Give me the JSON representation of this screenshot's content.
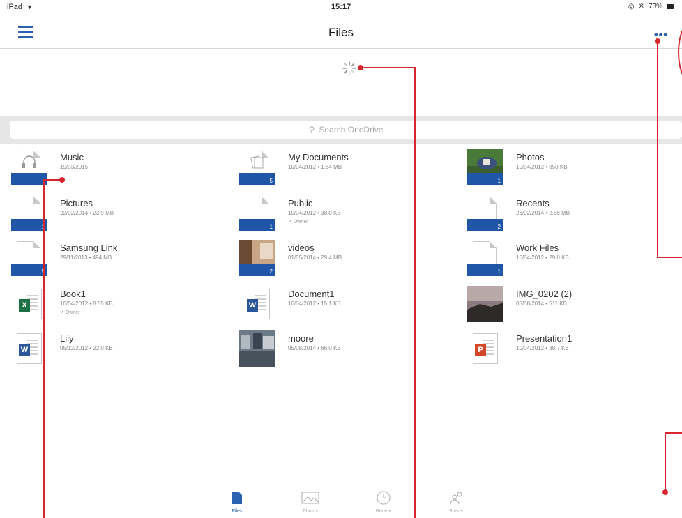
{
  "status_bar": {
    "device": "iPad",
    "time": "15:17",
    "battery": "73%"
  },
  "nav": {
    "title": "Files"
  },
  "search": {
    "placeholder": "Search OneDrive"
  },
  "files": [
    {
      "name": "Music",
      "sub": "19/03/2015",
      "kind": "folder",
      "icon": "headphones-icon"
    },
    {
      "name": "My Documents",
      "sub": "10/04/2012 • 1.84 MB",
      "kind": "folder",
      "count": "5",
      "icon": "documents-icon"
    },
    {
      "name": "Photos",
      "sub": "10/04/2012 • 850 KB",
      "kind": "photo-folder",
      "count": "1"
    },
    {
      "name": "Pictures",
      "sub": "22/02/2014 • 23.9 MB",
      "kind": "folder",
      "count": "1"
    },
    {
      "name": "Public",
      "sub": "10/04/2012 • 38.0 KB",
      "kind": "folder",
      "count": "1",
      "owner": "Owner"
    },
    {
      "name": "Recents",
      "sub": "26/02/2014 • 2.88 MB",
      "kind": "folder",
      "count": "2"
    },
    {
      "name": "Samsung Link",
      "sub": "29/11/2013 • 494 MB",
      "kind": "folder",
      "count": "5"
    },
    {
      "name": "videos",
      "sub": "01/05/2014 • 29.4 MB",
      "kind": "photo-folder",
      "count": "2"
    },
    {
      "name": "Work Files",
      "sub": "10/04/2012 • 29.0 KB",
      "kind": "folder",
      "count": "1"
    },
    {
      "name": "Book1",
      "sub": "10/04/2012 • 8.55 KB",
      "kind": "excel",
      "badge": "X",
      "owner": "Owner"
    },
    {
      "name": "Document1",
      "sub": "10/04/2012 • 15.1 KB",
      "kind": "word",
      "badge": "W"
    },
    {
      "name": "IMG_0202 (2)",
      "sub": "05/08/2014 • 511 KB",
      "kind": "image"
    },
    {
      "name": "Lily",
      "sub": "05/12/2012 • 22.0 KB",
      "kind": "word",
      "badge": "W"
    },
    {
      "name": "moore",
      "sub": "05/08/2014 • 66.0 KB",
      "kind": "image"
    },
    {
      "name": "Presentation1",
      "sub": "10/04/2012 • 38.7 KB",
      "kind": "powerpoint",
      "badge": "P"
    }
  ],
  "tabs": [
    {
      "label": "Files",
      "icon": "files-icon",
      "active": true
    },
    {
      "label": "Photos",
      "icon": "photos-icon",
      "active": false
    },
    {
      "label": "Recent",
      "icon": "clock-icon",
      "active": false
    },
    {
      "label": "Shared",
      "icon": "shared-people-icon",
      "active": false
    }
  ],
  "colors": {
    "accent": "#2a62b0",
    "folder": "#1f56a8",
    "annotation": "#d8262e",
    "excel": "#1e7145",
    "word": "#2b579a",
    "powerpoint": "#d24726"
  }
}
